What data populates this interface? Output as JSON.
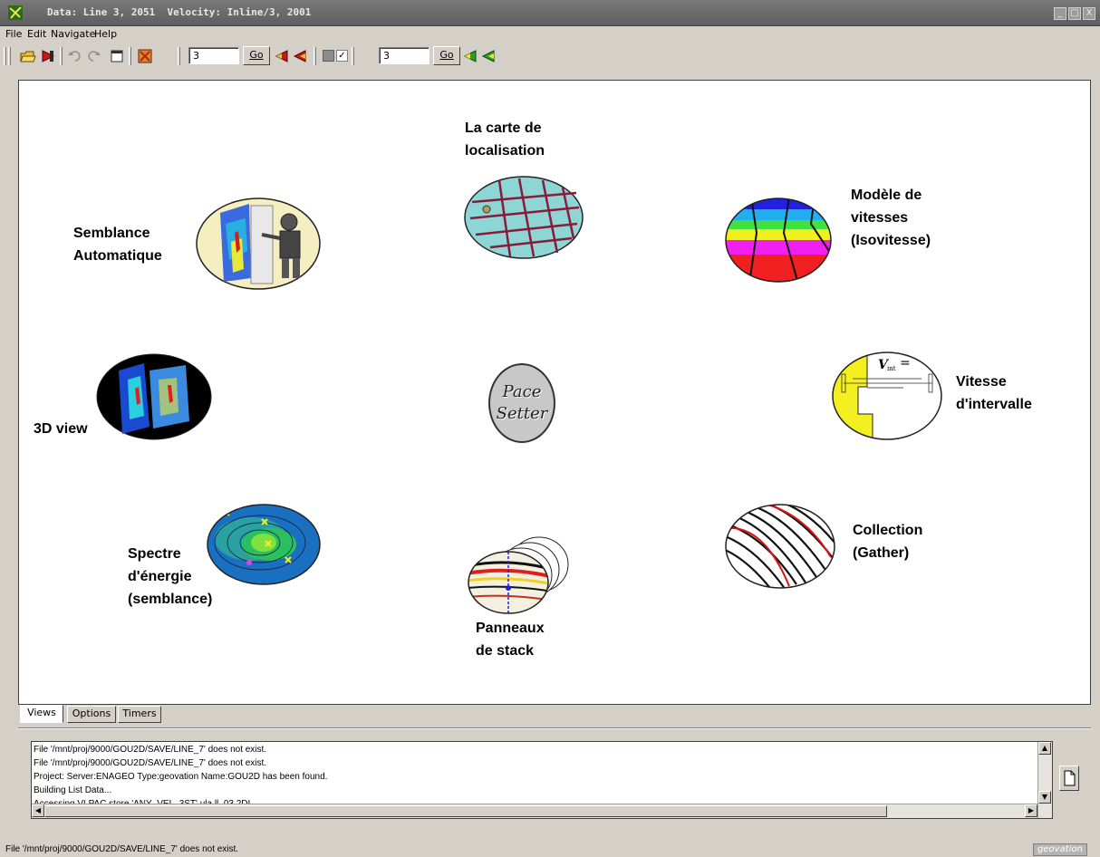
{
  "window": {
    "title": "Data: Line 3, 2051  Velocity: Inline/3, 2001",
    "buttons": [
      "_",
      "□",
      "X"
    ]
  },
  "menu": [
    {
      "label": "File"
    },
    {
      "label": "Edit"
    },
    {
      "label": "Navigate"
    },
    {
      "label": "Help"
    }
  ],
  "toolbar": {
    "data_value": "3",
    "data_go": "Go",
    "velocity_value": "3",
    "velocity_go": "Go",
    "check_mark": "✓"
  },
  "nodes": {
    "carte": "La carte de\nlocalisation",
    "semblance_auto": "Semblance\nAutomatique",
    "modele": "Modèle de\nvitesses\n(Isovitesse)",
    "view3d": "3D view",
    "vitesse_int": "Vitesse\nd'intervalle",
    "spectre": "Spectre\nd'énergie\n(semblance)",
    "collection": "Collection\n(Gather)",
    "panneaux": "Panneaux\nde stack",
    "pace_line1": "Pace",
    "pace_line2": "Setter"
  },
  "tabs": [
    {
      "label": "Views",
      "active": true
    },
    {
      "label": "Options",
      "active": false
    },
    {
      "label": "Timers",
      "active": false
    }
  ],
  "log": [
    "File '/mnt/proj/9000/GOU2D/SAVE/LINE_7' does not exist.",
    "File '/mnt/proj/9000/GOU2D/SAVE/LINE_7' does not exist.",
    "Project: Server:ENAGEO Type:geovation Name:GOU2D has been found.",
    "Building List Data...",
    "Accessing VLPAC store 'ANY_VEL_3ST' ula ll  03 2DI"
  ],
  "status": {
    "text": "File '/mnt/proj/9000/GOU2D/SAVE/LINE_7' does not exist.",
    "brand": "geovation"
  },
  "colors": {
    "desktop": "#d4d0c8",
    "titlebar": "#6b6b6b",
    "canvas": "#ffffff"
  }
}
